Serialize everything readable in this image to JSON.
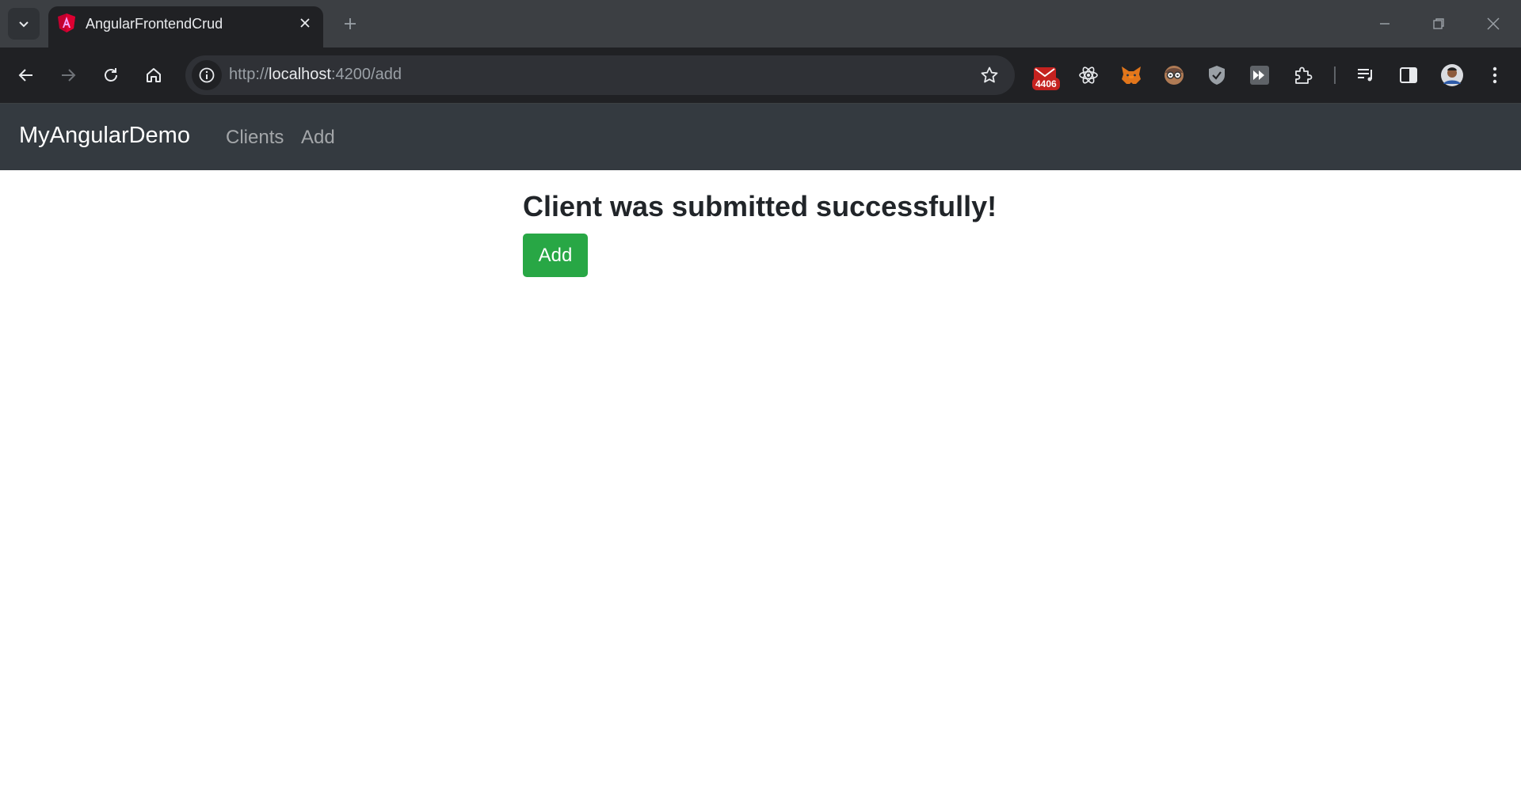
{
  "browser": {
    "tab_title": "AngularFrontendCrud",
    "url_scheme": "http://",
    "url_host": "localhost",
    "url_rest": ":4200/add",
    "extension_badge": "4406"
  },
  "icons": {
    "tab_search": "chevron-down-icon",
    "favicon": "angular-icon",
    "tab_close": "close-icon",
    "new_tab": "plus-icon",
    "back": "arrow-left-icon",
    "forward": "arrow-right-icon",
    "reload": "reload-icon",
    "home": "home-icon",
    "site_info": "info-icon",
    "bookmark": "star-icon"
  },
  "navbar": {
    "brand": "MyAngularDemo",
    "links": [
      "Clients",
      "Add"
    ]
  },
  "content": {
    "heading": "Client was submitted successfully!",
    "add_button": "Add"
  },
  "colors": {
    "navbar_bg": "#343a40",
    "success_button": "#28a745",
    "chrome_dark": "#202124"
  }
}
